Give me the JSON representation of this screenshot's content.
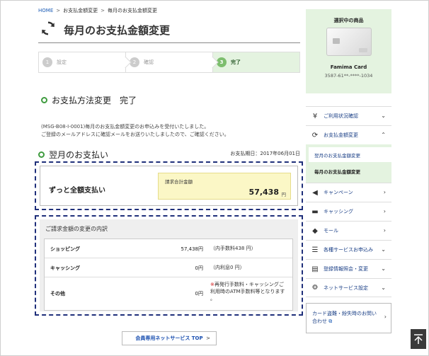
{
  "breadcrumb": {
    "home": "HOME",
    "sep": ">",
    "level1": "お支払金額変更",
    "level2": "毎月のお支払金額変更"
  },
  "page": {
    "title": "毎月のお支払金額変更"
  },
  "steps": [
    {
      "num": "1",
      "label": "設定"
    },
    {
      "num": "2",
      "label": "確認"
    },
    {
      "num": "3",
      "label": "完了"
    }
  ],
  "complete": {
    "heading": "お支払方法変更　完了",
    "message_line1": "(MSG-B08-I-0001)毎月のお支払金額変更のお申込みを受付いたしました。",
    "message_line2": "ご登録のメールアドレスに確認メールをお送りいたしましたので、ご確認ください。"
  },
  "next_payment": {
    "heading": "翌月のお支払い",
    "date_label": "お支払期日：2017年06月01日",
    "method": "ずっと全額支払い",
    "total_label": "請求合計金額",
    "total_value": "57,438",
    "total_unit": "円"
  },
  "breakdown": {
    "title": "ご請求金額の変更の内訳",
    "rows": [
      {
        "label": "ショッピング",
        "amount": "57,438円",
        "note": "（内手数料438 円）"
      },
      {
        "label": "キャッシング",
        "amount": "0円",
        "note": "（内利息0 円）"
      },
      {
        "label": "その他",
        "amount": "0円",
        "note_mark": "※",
        "note_line1": "再発行手数料・キャッシングご",
        "note_line2": "利用時のATM手数料等となります",
        "note_line3": "。"
      }
    ]
  },
  "bottom_button": {
    "label": "会員専用ネットサービス TOP",
    "chevron": ">"
  },
  "sidebar": {
    "selected_heading": "選択中の商品",
    "card_name": "Famima Card",
    "card_number": "3587-61**-****-1034",
    "menu": [
      {
        "icon": "yen-icon",
        "label": "ご利用状況確認"
      },
      {
        "icon": "refresh-icon",
        "label": "お支払金額変更",
        "sub": [
          "翌月のお支払金額変更",
          "毎月のお支払金額変更"
        ]
      },
      {
        "icon": "megaphone-icon",
        "label": "キャンペーン"
      },
      {
        "icon": "cash-icon",
        "label": "キャッシング"
      },
      {
        "icon": "tag-icon",
        "label": "モール"
      },
      {
        "icon": "list-icon",
        "label": "各種サービスお申込み"
      },
      {
        "icon": "document-icon",
        "label": "登録情報照会・変更"
      },
      {
        "icon": "gear-icon",
        "label": "ネットサービス設定"
      }
    ],
    "contact_line1": "カード盗難・紛失時のお問い",
    "contact_line2": "合わせ"
  },
  "colors": {
    "accent_green": "#e4f3e0",
    "dashed_border": "#1f2f7a",
    "link_blue": "#1a3f86"
  }
}
